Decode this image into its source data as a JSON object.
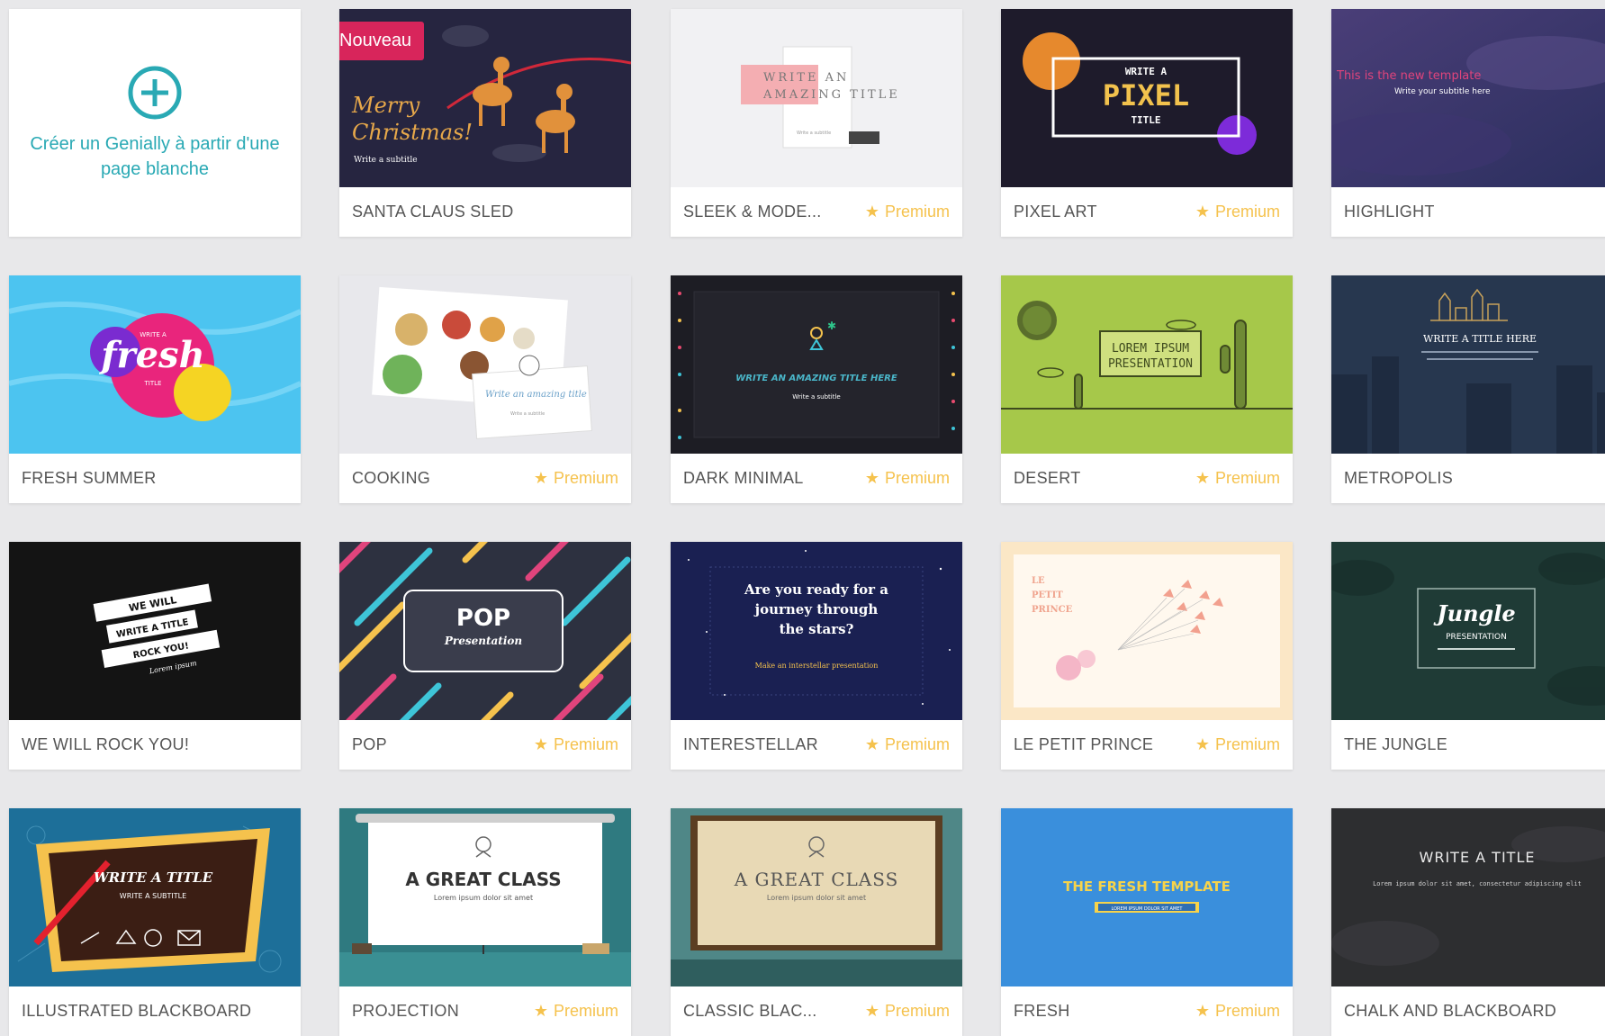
{
  "create_card": {
    "text": "Créer un Genially à partir d'une page blanche",
    "icon": "plus-circle-icon",
    "color": "#29a9b4"
  },
  "premium_label": "Premium",
  "premium_color": "#f5c24d",
  "badge_new": "Nouveau",
  "templates": [
    {
      "id": "santa-claus-sled",
      "name": "SANTA CLAUS SLED",
      "premium": false,
      "is_new": true,
      "preview": {
        "line1": "Merry",
        "line2": "Christmas!",
        "line3": "Write a subtitle"
      }
    },
    {
      "id": "sleek-modern",
      "name": "SLEEK & MODE...",
      "premium": true,
      "preview": {
        "line1": "WRITE AN",
        "line2": "AMAZING TITLE",
        "line3": "Write a subtitle"
      }
    },
    {
      "id": "pixel-art",
      "name": "PIXEL ART",
      "premium": true,
      "preview": {
        "line1": "WRITE A",
        "line2": "PIXEL",
        "line3": "TITLE"
      }
    },
    {
      "id": "highlight",
      "name": "HIGHLIGHT",
      "premium": false,
      "preview": {
        "line1": "This is the new template",
        "line2": "Write your subtitle here"
      }
    },
    {
      "id": "fresh-summer",
      "name": "FRESH SUMMER",
      "premium": false,
      "preview": {
        "line1": "WRITE A",
        "line2": "fresh",
        "line3": "TITLE"
      }
    },
    {
      "id": "cooking",
      "name": "COOKING",
      "premium": true,
      "preview": {
        "line1": "Write an amazing title",
        "line2": "Write a subtitle"
      }
    },
    {
      "id": "dark-minimal",
      "name": "DARK MINIMAL",
      "premium": true,
      "preview": {
        "line1": "WRITE AN AMAZING TITLE HERE",
        "line2": "Write a subtitle"
      }
    },
    {
      "id": "desert",
      "name": "DESERT",
      "premium": true,
      "preview": {
        "line1": "LOREM IPSUM",
        "line2": "PRESENTATION"
      }
    },
    {
      "id": "metropolis",
      "name": "METROPOLIS",
      "premium": false,
      "preview": {
        "line1": "WRITE A TITLE HERE"
      }
    },
    {
      "id": "we-will-rock-you",
      "name": "WE WILL ROCK YOU!",
      "premium": false,
      "preview": {
        "line1": "WE WILL",
        "line2": "WRITE A TITLE",
        "line3": "ROCK YOU!",
        "line4": "Lorem ipsum"
      }
    },
    {
      "id": "pop",
      "name": "POP",
      "premium": true,
      "preview": {
        "line1": "POP",
        "line2": "Presentation"
      }
    },
    {
      "id": "interestellar",
      "name": "INTERESTELLAR",
      "premium": true,
      "preview": {
        "line1": "Are you ready for a",
        "line2": "journey through",
        "line3": "the stars?",
        "line4": "Make an interstellar presentation"
      }
    },
    {
      "id": "le-petit-prince",
      "name": "LE PETIT PRINCE",
      "premium": true,
      "preview": {
        "line1": "LE",
        "line2": "PETIT",
        "line3": "PRINCE"
      }
    },
    {
      "id": "the-jungle",
      "name": "THE JUNGLE",
      "premium": false,
      "preview": {
        "line1": "Jungle",
        "line2": "PRESENTATION"
      }
    },
    {
      "id": "illustrated-blackboard",
      "name": "ILLUSTRATED BLACKBOARD",
      "premium": false,
      "preview": {
        "line1": "WRITE A TITLE",
        "line2": "WRITE A SUBTITLE"
      }
    },
    {
      "id": "projection",
      "name": "PROJECTION",
      "premium": true,
      "preview": {
        "line1": "A GREAT CLASS",
        "line2": "Lorem ipsum dolor sit amet"
      }
    },
    {
      "id": "classic-blackboard",
      "name": "CLASSIC BLAC...",
      "premium": true,
      "preview": {
        "line1": "A GREAT CLASS",
        "line2": "Lorem ipsum dolor sit amet"
      }
    },
    {
      "id": "fresh",
      "name": "FRESH",
      "premium": true,
      "preview": {
        "line1": "THE FRESH TEMPLATE",
        "line2": "LOREM IPSUM DOLOR SIT AMET"
      }
    },
    {
      "id": "chalk-and-blackboard",
      "name": "CHALK AND BLACKBOARD",
      "premium": false,
      "preview": {
        "line1": "WRITE A TITLE",
        "line2": "Lorem ipsum dolor sit amet, consectetur adipiscing elit"
      }
    }
  ]
}
